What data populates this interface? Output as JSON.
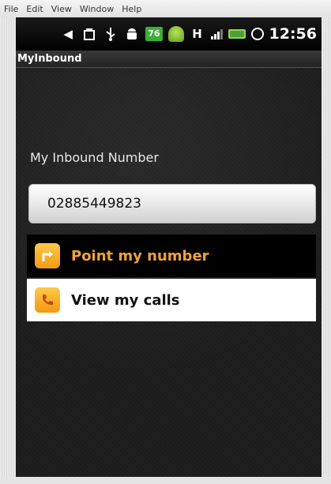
{
  "menubar": {
    "items": [
      "File",
      "Edit",
      "View",
      "Window",
      "Help"
    ]
  },
  "statusbar": {
    "icons": [
      "back-icon",
      "bag-icon",
      "usb-icon",
      "android-debug-icon",
      "download-badge-icon",
      "android-icon",
      "h-network-icon",
      "signal-icon",
      "battery-icon",
      "alarm-icon"
    ],
    "badge": "76",
    "network": "H",
    "time": "12:56"
  },
  "app": {
    "title": "MyInbound",
    "inbound_label": "My Inbound Number",
    "inbound_number": "02885449823",
    "menu": [
      {
        "label": "Point my number",
        "icon": "point-arrow-icon",
        "selected": true
      },
      {
        "label": "View my calls",
        "icon": "phone-icon",
        "selected": false
      }
    ]
  },
  "colors": {
    "accent": "#f0a33a",
    "icon_orange": "#f19a10",
    "screen_bg": "#1d1d1d",
    "status_green": "#3cae36"
  }
}
